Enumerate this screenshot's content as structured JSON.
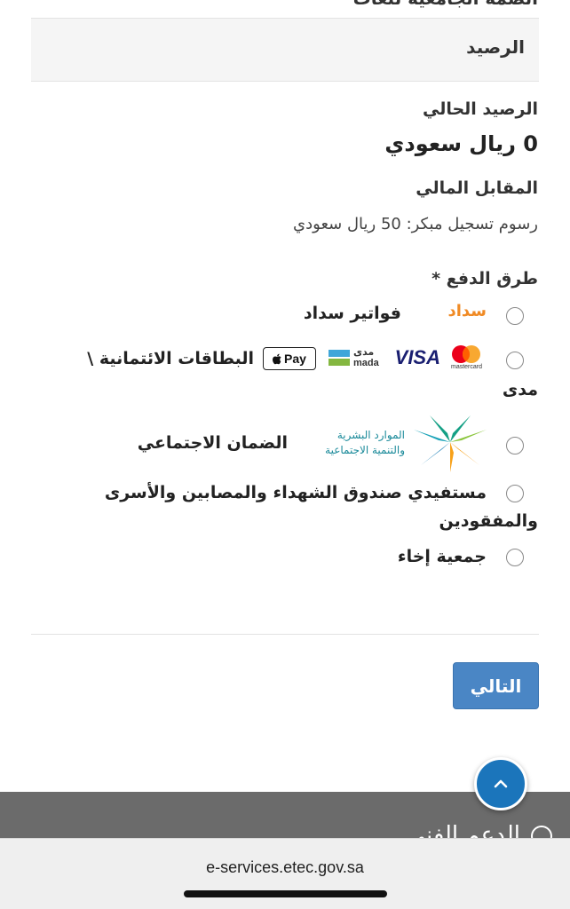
{
  "partial_top_text": "الضمة الجامعية للغات",
  "panel": {
    "title": "الرصيد"
  },
  "balance": {
    "current_label": "الرصيد الحالي",
    "current_value": "0 ريال سعودي",
    "fee_label": "المقابل المالي",
    "fee_text": "رسوم تسجيل مبكر: 50 ريال سعودي"
  },
  "payment": {
    "label": "طرق الدفع *",
    "options": [
      {
        "label": "فواتير سداد",
        "logo": "سداد"
      },
      {
        "label": "البطاقات الائتمانية \\",
        "label_line2": "مدى",
        "logos": {
          "applepay": "Pay",
          "mada_ar": "مدى",
          "mada_en": "mada",
          "visa": "VISA",
          "mastercard": "mastercard"
        }
      },
      {
        "label": "الضمان الاجتماعي",
        "logo_line1": "الموارد البشرية",
        "logo_line2": "والتنمية الاجتماعية"
      },
      {
        "label": "مستفيدي صندوق الشهداء والمصابين والأسرى",
        "label_line2": "والمفقودين"
      },
      {
        "label": "جمعية إخاء"
      }
    ]
  },
  "next_button": "التالي",
  "footer": {
    "support": "الدعم الفني"
  },
  "browser": {
    "url": "e-services.etec.gov.sa"
  },
  "colors": {
    "button": "#4a86c5",
    "scroll_top": "#1b75bb",
    "footer": "#6b6b6b",
    "sadad": "#f08a24"
  }
}
